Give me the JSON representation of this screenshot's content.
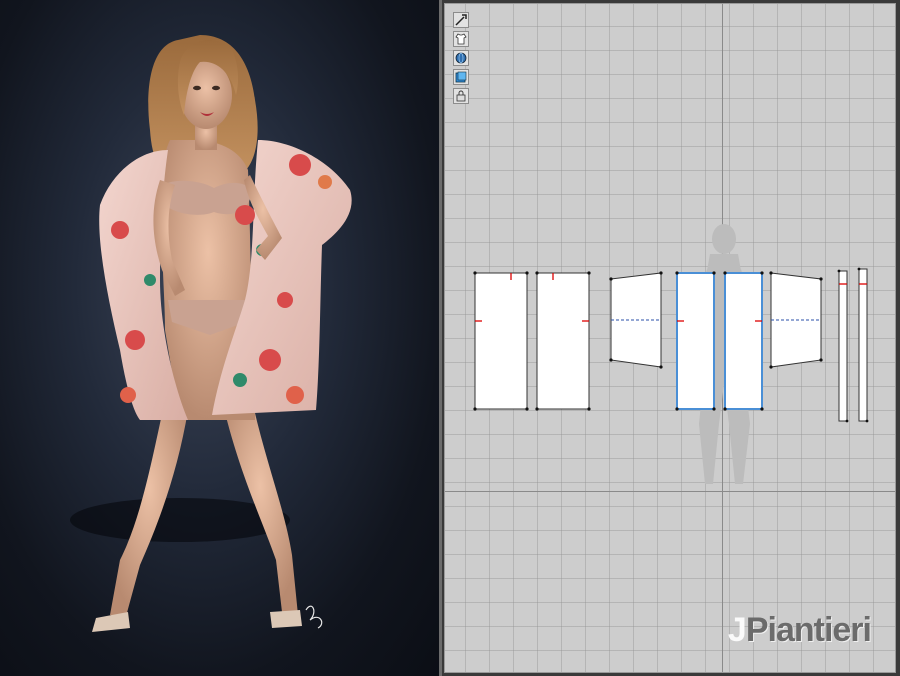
{
  "toolbar": {
    "tools": [
      {
        "name": "transform-pattern-tool",
        "icon": "arrow-pen-icon"
      },
      {
        "name": "garment-tool",
        "icon": "shirt-icon"
      },
      {
        "name": "avatar-view-tool",
        "icon": "globe-icon"
      },
      {
        "name": "fabric-tool",
        "icon": "fabric-swatch-icon"
      },
      {
        "name": "lock-tool",
        "icon": "lock-icon"
      }
    ]
  },
  "colors": {
    "viewport_bg": "#11151e",
    "pattern_bg": "#cdcdcd",
    "selected_outline": "#4a8fd6",
    "piece_fill": "#ffffff"
  },
  "watermark": {
    "initial": "J",
    "name": "Piantieri"
  }
}
